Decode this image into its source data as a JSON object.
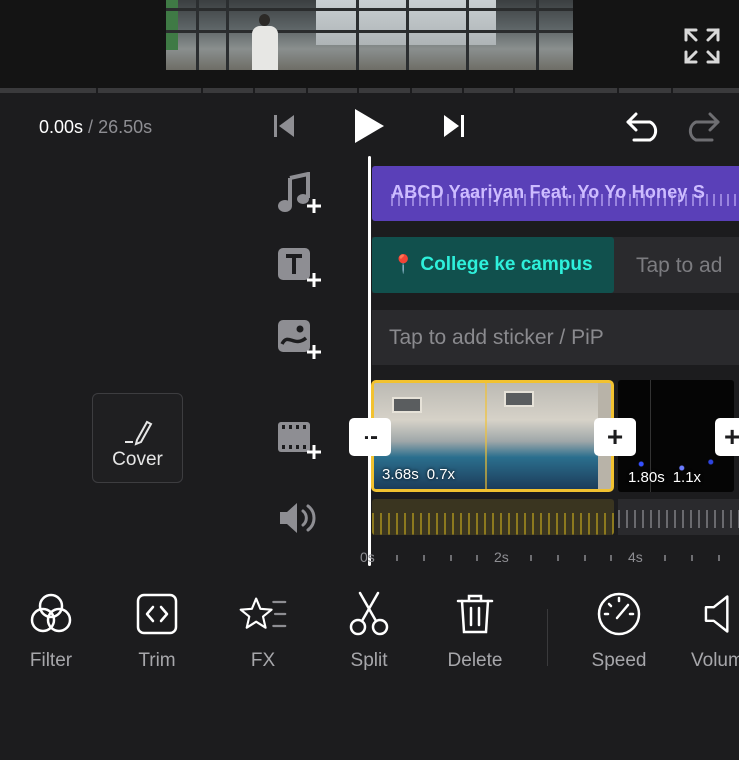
{
  "time": {
    "current": "0.00s",
    "separator": " / ",
    "total": "26.50s"
  },
  "timeline": {
    "music_clip_title": "ABCD Yaariyan Feat. Yo Yo Honey S",
    "text_clip_label": "College ke campus",
    "text_track_placeholder": "Tap to ad",
    "sticker_track_placeholder": "Tap to add sticker / PiP",
    "clips": [
      {
        "duration": "3.68s",
        "speed": "0.7x"
      },
      {
        "duration": "1.80s",
        "speed": "1.1x"
      }
    ],
    "trim_handle_label": "--",
    "add_label": "+",
    "ruler": [
      "0s",
      "2s",
      "4s"
    ]
  },
  "cover": {
    "label": "Cover"
  },
  "toolbar": {
    "items": [
      {
        "label": "Filter",
        "icon": "filter-icon"
      },
      {
        "label": "Trim",
        "icon": "trim-icon"
      },
      {
        "label": "FX",
        "icon": "fx-icon"
      },
      {
        "label": "Split",
        "icon": "scissors-icon"
      },
      {
        "label": "Delete",
        "icon": "trash-icon"
      },
      {
        "label": "Speed",
        "icon": "speedometer-icon"
      },
      {
        "label": "Volum",
        "icon": "volume-icon"
      }
    ]
  },
  "colors": {
    "background": "#1c1c1e",
    "music_track": "#5a40b8",
    "text_clip": "#11504d",
    "text_clip_label": "#2ef0db",
    "selected_clip_border": "#f2c230"
  }
}
